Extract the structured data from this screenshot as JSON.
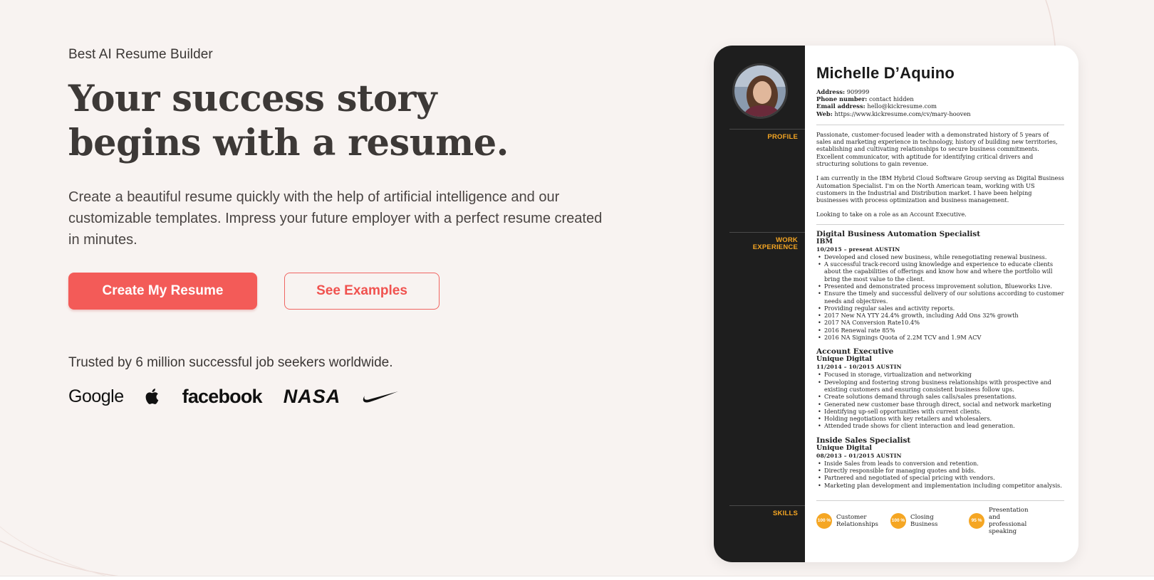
{
  "hero": {
    "eyebrow": "Best AI Resume Builder",
    "headline_line1": "Your success story",
    "headline_line2": "begins with a resume.",
    "subtext": "Create a beautiful resume quickly with the help of artificial intelligence and our customizable templates. Impress your future employer with a perfect resume created in minutes.",
    "primary_cta": "Create My Resume",
    "secondary_cta": "See Examples",
    "trust_text": "Trusted by 6 million successful job seekers worldwide."
  },
  "logos": {
    "google": "Google",
    "apple": "apple-logo-icon",
    "facebook": "facebook",
    "nasa": "NASA",
    "nike": "nike-swoosh-icon"
  },
  "resume": {
    "name": "Michelle D’Aquino",
    "contact": {
      "address_label": "Address:",
      "address": "909999",
      "phone_label": "Phone number:",
      "phone": "contact hidden",
      "email_label": "Email address:",
      "email": "hello@kickresume.com",
      "web_label": "Web:",
      "web": "https://www.kickresume.com/cv/mary-hooven"
    },
    "section_labels": {
      "profile": "PROFILE",
      "work_1": "WORK",
      "work_2": "EXPERIENCE",
      "skills": "SKILLS"
    },
    "profile": [
      "Passionate, customer-focused leader with a demonstrated history of 5 years of sales and marketing experience in technology, history of building new territories, establishing and cultivating relationships to secure business commitments. Excellent communicator, with aptitude for identifying critical drivers and structuring solutions to gain revenue.",
      "I am currently in the IBM Hybrid Cloud Software Group serving as Digital Business Automation Specialist. I'm on the North American team, working with US customers in the Industrial and Distribution market. I have been helping businesses with process optimization and business management.",
      "Looking to take on a role as an Account Executive."
    ],
    "jobs": [
      {
        "title": "Digital Business Automation Specialist",
        "company": "IBM",
        "meta": "10/2015 – present  AUSTIN",
        "bullets": [
          "Developed and closed new business, while renegotiating renewal business.",
          "A successful track-record using knowledge and experience  to educate clients about the capabilities of offerings and know how and where the portfolio will bring the most value to the client.",
          "Presented and demonstrated process improvement solution, Blueworks Live.",
          "Ensure the timely and successful delivery of our solutions according to customer needs and objectives.",
          "Providing regular sales and activity reports.",
          "2017 New NA YTY 24.4% growth, including Add Ons 32% growth",
          "2017 NA Conversion Rate10.4%",
          "2016 Renewal rate 85%",
          "2016 NA Signings Quota of 2.2M TCV and 1.9M ACV"
        ]
      },
      {
        "title": "Account Executive",
        "company": "Unique Digital",
        "meta": "11/2014 – 10/2015  AUSTIN",
        "bullets": [
          "Focused in storage, virtualization and networking",
          "Developing and fostering strong business relationships with prospective and existing customers and ensuring consistent business follow ups.",
          "Create solutions demand through sales calls/sales presentations.",
          "Generated new customer base through direct, social and network marketing",
          "Identifying up-sell opportunities with current clients.",
          "Holding negotiations with key retailers and wholesalers.",
          "Attended trade shows for client interaction and lead generation."
        ]
      },
      {
        "title": "Inside Sales Specialist",
        "company": "Unique Digital",
        "meta": "08/2013 – 01/2015  AUSTIN",
        "bullets": [
          "Inside Sales from leads to conversion and retention.",
          "Directly responsible for managing quotes and bids.",
          "Partnered and negotiated of special pricing with vendors.",
          "Marketing plan development and implementation including competitor analysis."
        ]
      }
    ],
    "skills": [
      {
        "level": "100 %",
        "name": "Customer Relationships"
      },
      {
        "level": "100 %",
        "name": "Closing Business"
      },
      {
        "level": "95 %",
        "name": "Presentation and professional speaking"
      }
    ]
  }
}
